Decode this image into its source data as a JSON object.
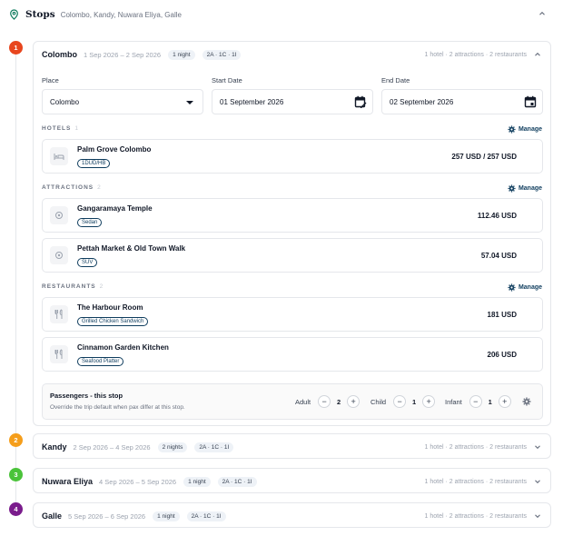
{
  "header": {
    "title": "Stops",
    "route": "Colombo, Kandy, Nuwara Eliya, Galle"
  },
  "colors": {
    "accent": "#0f3d5e",
    "stop1": "#e8461e",
    "stop2": "#f59e1b",
    "stop3": "#4ac33a",
    "stop4": "#7a1c8c"
  },
  "stops": [
    {
      "num": "1",
      "city": "Colombo",
      "dates": "1 Sep 2026 – 2 Sep 2026",
      "nights": "1 night",
      "pax": "2A · 1C · 1I",
      "summary": "1 hotel · 2 attractions · 2 restaurants",
      "expanded": true
    },
    {
      "num": "2",
      "city": "Kandy",
      "dates": "2 Sep 2026 – 4 Sep 2026",
      "nights": "2 nights",
      "pax": "2A · 1C · 1I",
      "summary": "1 hotel · 2 attractions · 2 restaurants"
    },
    {
      "num": "3",
      "city": "Nuwara Eliya",
      "dates": "4 Sep 2026 – 5 Sep 2026",
      "nights": "1 night",
      "pax": "2A · 1C · 1I",
      "summary": "1 hotel · 2 attractions · 2 restaurants"
    },
    {
      "num": "4",
      "city": "Galle",
      "dates": "5 Sep 2026 – 6 Sep 2026",
      "nights": "1 night",
      "pax": "2A · 1C · 1I",
      "summary": "1 hotel · 2 attractions · 2 restaurants"
    }
  ],
  "form": {
    "place_label": "Place",
    "place_value": "Colombo",
    "start_label": "Start Date",
    "start_value": "01 September 2026",
    "end_label": "End Date",
    "end_value": "02 September 2026"
  },
  "hotels": {
    "title": "HOTELS",
    "count": "1",
    "manage": "Manage",
    "items": [
      {
        "name": "Palm Grove Colombo",
        "tag": "1DUD/HB",
        "price": "257 USD / 257 USD"
      }
    ]
  },
  "attractions": {
    "title": "ATTRACTIONS",
    "count": "2",
    "manage": "Manage",
    "items": [
      {
        "name": "Gangaramaya Temple",
        "tag": "Sedan",
        "price": "112.46 USD"
      },
      {
        "name": "Pettah Market & Old Town Walk",
        "tag": "SUV",
        "price": "57.04 USD"
      }
    ]
  },
  "restaurants": {
    "title": "RESTAURANTS",
    "count": "2",
    "manage": "Manage",
    "items": [
      {
        "name": "The Harbour Room",
        "tag": "Grilled Chicken Sandwich",
        "price": "181 USD"
      },
      {
        "name": "Cinnamon Garden Kitchen",
        "tag": "Seafood Platter",
        "price": "206 USD"
      }
    ]
  },
  "passengers": {
    "title": "Passengers - this stop",
    "subtitle": "Override the trip default when pax differ at this stop.",
    "adult_label": "Adult",
    "adult_value": "2",
    "child_label": "Child",
    "child_value": "1",
    "infant_label": "Infant",
    "infant_value": "1"
  }
}
